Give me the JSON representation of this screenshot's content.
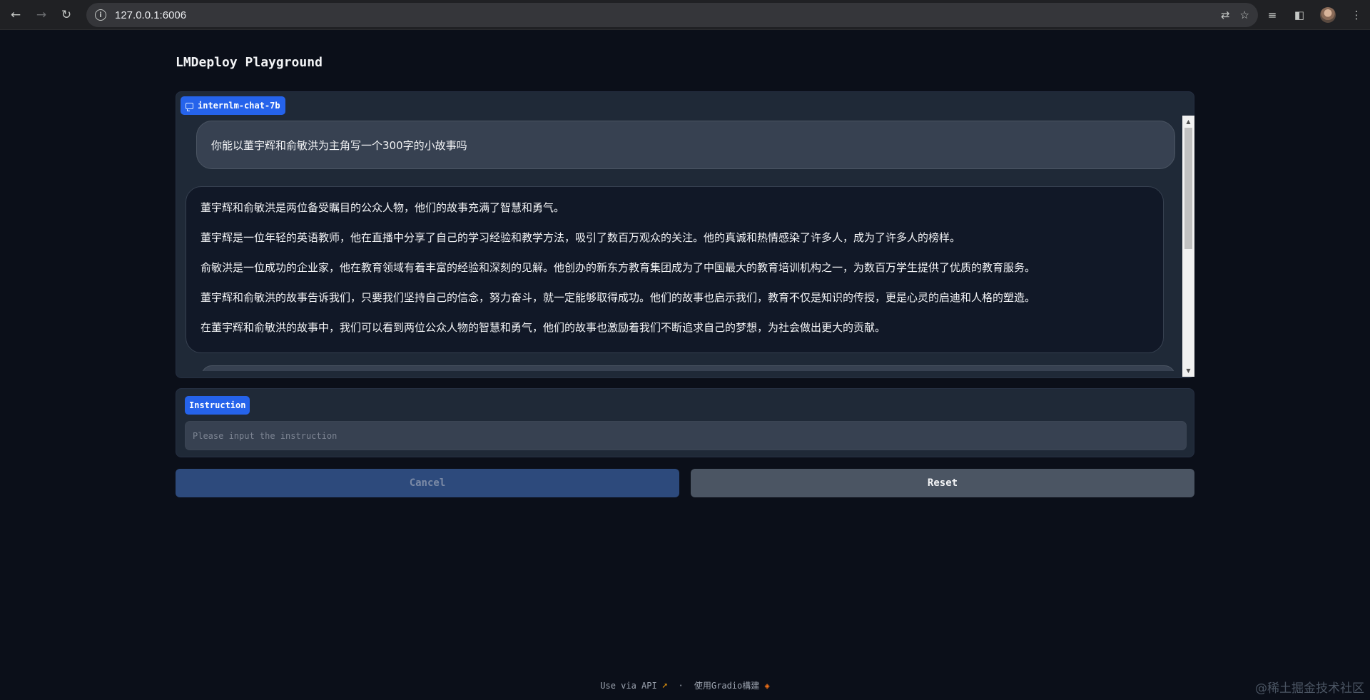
{
  "browser": {
    "url": "127.0.0.1:6006",
    "back_icon": "←",
    "forward_icon": "→",
    "reload_icon": "↻",
    "info_icon": "i",
    "translate_icon": "⇄",
    "star_icon": "☆",
    "media_icon": "≡",
    "sidepanel_icon": "◧",
    "menu_icon": "⋮"
  },
  "app": {
    "title": "LMDeploy Playground"
  },
  "chat": {
    "model_label": "internlm-chat-7b",
    "user_message": "你能以董宇辉和俞敏洪为主角写一个300字的小故事吗",
    "bot_paragraphs": [
      "董宇辉和俞敏洪是两位备受瞩目的公众人物，他们的故事充满了智慧和勇气。",
      "董宇辉是一位年轻的英语教师，他在直播中分享了自己的学习经验和教学方法，吸引了数百万观众的关注。他的真诚和热情感染了许多人，成为了许多人的榜样。",
      "俞敏洪是一位成功的企业家，他在教育领域有着丰富的经验和深刻的见解。他创办的新东方教育集团成为了中国最大的教育培训机构之一，为数百万学生提供了优质的教育服务。",
      "董宇辉和俞敏洪的故事告诉我们，只要我们坚持自己的信念，努力奋斗，就一定能够取得成功。他们的故事也启示我们，教育不仅是知识的传授，更是心灵的启迪和人格的塑造。",
      "在董宇辉和俞敏洪的故事中，我们可以看到两位公众人物的智慧和勇气，他们的故事也激励着我们不断追求自己的梦想，为社会做出更大的贡献。"
    ]
  },
  "instruction": {
    "label": "Instruction",
    "placeholder": "Please input the instruction",
    "value": ""
  },
  "buttons": {
    "cancel": "Cancel",
    "reset": "Reset"
  },
  "footer": {
    "api_text": "Use via API",
    "separator": "·",
    "built_with": "使用Gradio構建"
  },
  "watermark": "@稀土掘金技术社区",
  "colors": {
    "background": "#0b0f19",
    "panel": "#1f2937",
    "accent": "#2563eb"
  }
}
